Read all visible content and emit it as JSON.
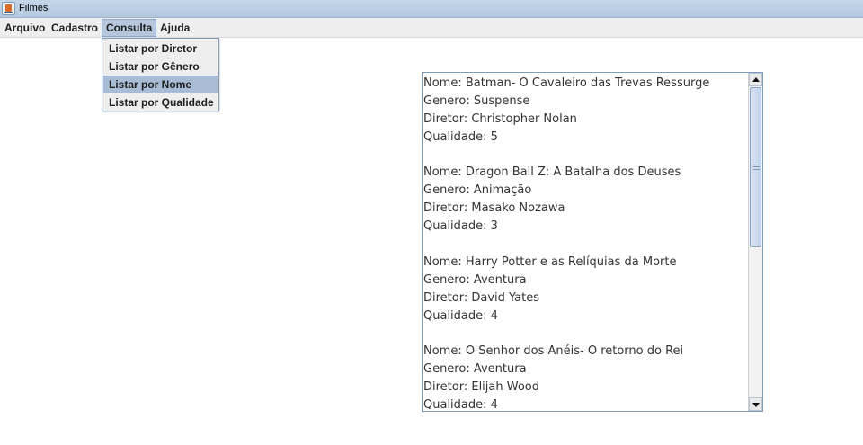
{
  "window": {
    "title": "Filmes",
    "icon": "java-cup-icon"
  },
  "menubar": {
    "items": [
      {
        "label": "Arquivo"
      },
      {
        "label": "Cadastro"
      },
      {
        "label": "Consulta",
        "active": true
      },
      {
        "label": "Ajuda"
      }
    ]
  },
  "dropdown": {
    "items": [
      {
        "label": "Listar por Diretor"
      },
      {
        "label": "Listar por Gênero"
      },
      {
        "label": "Listar por Nome",
        "highlighted": true
      },
      {
        "label": "Listar por Qualidade"
      }
    ]
  },
  "results": {
    "lines": [
      "Nome: Batman- O Cavaleiro das Trevas Ressurge",
      "Genero: Suspense",
      "Diretor: Christopher Nolan",
      "Qualidade: 5",
      "",
      "Nome: Dragon Ball Z: A Batalha dos Deuses",
      "Genero: Animação",
      "Diretor: Masako Nozawa",
      "Qualidade: 3",
      "",
      "Nome: Harry Potter e as Relíquias da Morte",
      "Genero: Aventura",
      "Diretor: David Yates",
      "Qualidade: 4",
      "",
      "Nome: O Senhor dos Anéis- O retorno do Rei",
      "Genero: Aventura",
      "Diretor: Elijah Wood",
      "Qualidade: 4"
    ]
  },
  "colors": {
    "menu_active_bg": "#b6c6dd",
    "dropdown_highlight_bg": "#a9bcd6",
    "border": "#7f9db9"
  }
}
